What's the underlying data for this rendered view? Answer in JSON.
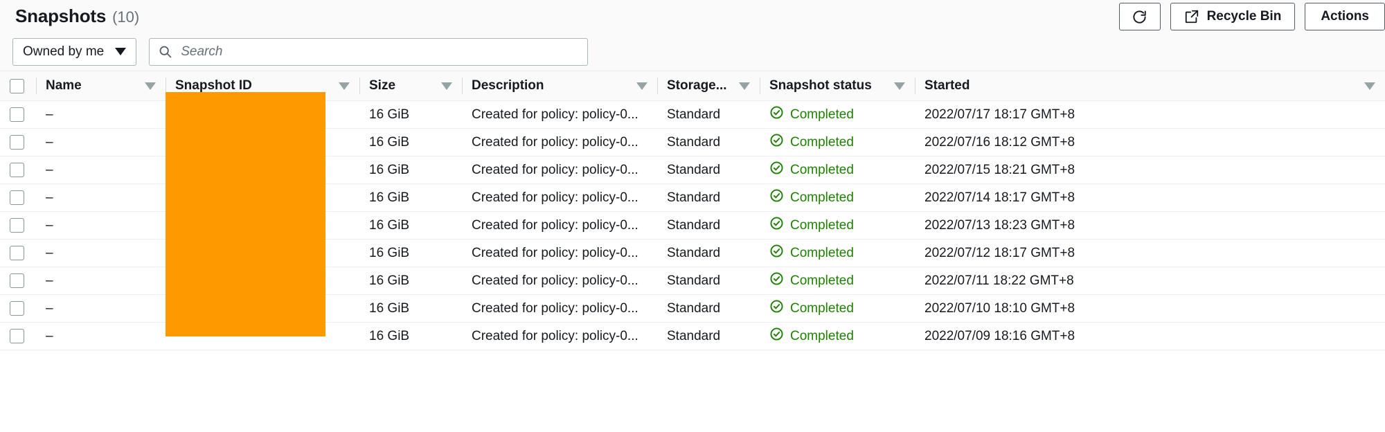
{
  "header": {
    "title": "Snapshots",
    "count": "(10)",
    "refresh_icon": "refresh-icon",
    "recycle_bin_label": "Recycle Bin",
    "recycle_bin_icon": "external-link-icon",
    "actions_label": "Actions"
  },
  "filters": {
    "owner_dropdown": {
      "value": "Owned by me",
      "icon": "chevron-down-icon"
    },
    "search": {
      "placeholder": "Search",
      "value": "",
      "icon": "search-icon"
    }
  },
  "table": {
    "select_all_checkbox": "unchecked",
    "sort_icon": "sort-caret-icon",
    "columns": [
      {
        "key": "name",
        "label": "Name",
        "sortable": true
      },
      {
        "key": "snapid",
        "label": "Snapshot ID",
        "sortable": true
      },
      {
        "key": "size",
        "label": "Size",
        "sortable": true
      },
      {
        "key": "desc",
        "label": "Description",
        "sortable": true
      },
      {
        "key": "store",
        "label": "Storage...",
        "sortable": true
      },
      {
        "key": "status",
        "label": "Snapshot status",
        "sortable": true
      },
      {
        "key": "start",
        "label": "Started",
        "sortable": true
      }
    ],
    "status_icon": "check-circle-icon",
    "rows": [
      {
        "name": "–",
        "snapshot_id": "",
        "size": "16 GiB",
        "description": "Created for policy: policy-0...",
        "storage_tier": "Standard",
        "status": "Completed",
        "started": "2022/07/17 18:17 GMT+8"
      },
      {
        "name": "–",
        "snapshot_id": "",
        "size": "16 GiB",
        "description": "Created for policy: policy-0...",
        "storage_tier": "Standard",
        "status": "Completed",
        "started": "2022/07/16 18:12 GMT+8"
      },
      {
        "name": "–",
        "snapshot_id": "",
        "size": "16 GiB",
        "description": "Created for policy: policy-0...",
        "storage_tier": "Standard",
        "status": "Completed",
        "started": "2022/07/15 18:21 GMT+8"
      },
      {
        "name": "–",
        "snapshot_id": "",
        "size": "16 GiB",
        "description": "Created for policy: policy-0...",
        "storage_tier": "Standard",
        "status": "Completed",
        "started": "2022/07/14 18:17 GMT+8"
      },
      {
        "name": "–",
        "snapshot_id": "",
        "size": "16 GiB",
        "description": "Created for policy: policy-0...",
        "storage_tier": "Standard",
        "status": "Completed",
        "started": "2022/07/13 18:23 GMT+8"
      },
      {
        "name": "–",
        "snapshot_id": "",
        "size": "16 GiB",
        "description": "Created for policy: policy-0...",
        "storage_tier": "Standard",
        "status": "Completed",
        "started": "2022/07/12 18:17 GMT+8"
      },
      {
        "name": "–",
        "snapshot_id": "",
        "size": "16 GiB",
        "description": "Created for policy: policy-0...",
        "storage_tier": "Standard",
        "status": "Completed",
        "started": "2022/07/11 18:22 GMT+8"
      },
      {
        "name": "–",
        "snapshot_id": "",
        "size": "16 GiB",
        "description": "Created for policy: policy-0...",
        "storage_tier": "Standard",
        "status": "Completed",
        "started": "2022/07/10 18:10 GMT+8"
      },
      {
        "name": "–",
        "snapshot_id": "",
        "size": "16 GiB",
        "description": "Created for policy: policy-0...",
        "storage_tier": "Standard",
        "status": "Completed",
        "started": "2022/07/09 18:16 GMT+8"
      }
    ]
  },
  "redaction": {
    "label": "snapshot-id-redaction",
    "color": "#ff9900"
  },
  "colors": {
    "accent_orange": "#ff9900",
    "status_green": "#1d8102",
    "text_primary": "#16191f",
    "text_secondary": "#687078",
    "border": "#eaeded",
    "panel_bg": "#fafafa"
  }
}
